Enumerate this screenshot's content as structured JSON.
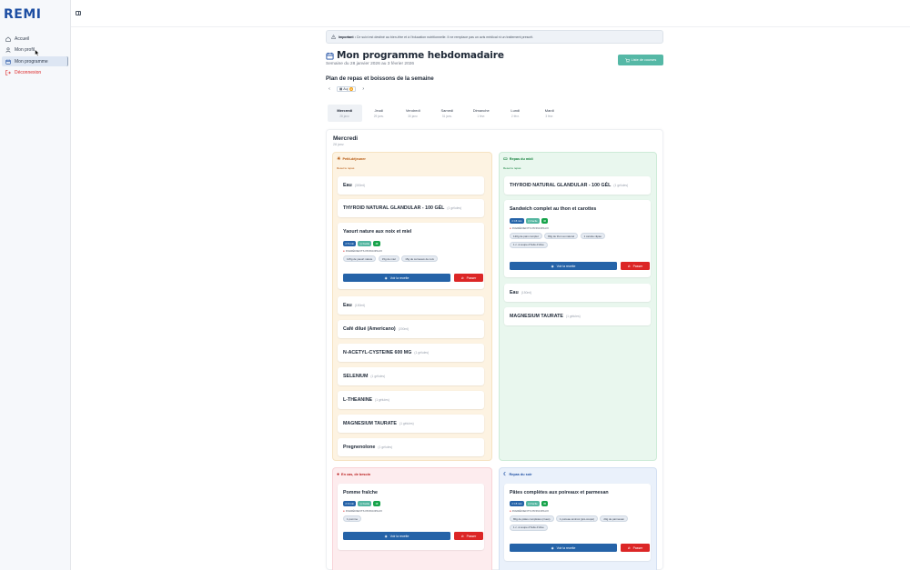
{
  "app": {
    "logo": "REMI"
  },
  "sidebar": {
    "items": [
      {
        "label": "Accueil",
        "icon": "home-icon"
      },
      {
        "label": "Mon profil",
        "icon": "user-icon"
      },
      {
        "label": "Mon programme",
        "icon": "calendar-icon",
        "active": true
      },
      {
        "label": "Déconnexion",
        "icon": "logout-icon"
      }
    ]
  },
  "banner": {
    "label": "Important :",
    "text": "Ce suivi est destiné au bien-être et à l'éducation nutritionnelle. Il ne remplace pas un avis médical ni un traitement prescrit."
  },
  "header": {
    "title": "Mon programme hebdomadaire",
    "subtitle": "Semaine du 28 janvier 2026 au 3 février 2026",
    "shopping_button": "Liste de courses"
  },
  "plan": {
    "title": "Plan de repas et boissons de la semaine",
    "today_label": "Auj",
    "today_badge": "●",
    "days": [
      {
        "name": "Mercredi",
        "date": "28 janv."
      },
      {
        "name": "Jeudi",
        "date": "29 janv."
      },
      {
        "name": "Vendredi",
        "date": "30 janv."
      },
      {
        "name": "Samedi",
        "date": "31 janv."
      },
      {
        "name": "Dimanche",
        "date": "1 févr."
      },
      {
        "name": "Lundi",
        "date": "2 févr."
      },
      {
        "name": "Mardi",
        "date": "3 févr."
      }
    ]
  },
  "selected_day": {
    "name": "Mercredi",
    "date": "28 janv."
  },
  "labels": {
    "recipe_button": "Voir la recette",
    "pass_button": "Passer",
    "ingredients": "INGRÉDIENTS PRINCIPAUX",
    "reset": "Reset le repas"
  },
  "colors": {
    "primary": "#2563a8",
    "teal": "#55b8a6",
    "danger": "#dc2626"
  },
  "meals": {
    "breakfast": {
      "title": "Petit-déjeuner",
      "items": [
        {
          "name": "Eau",
          "qty": "(300ml)"
        },
        {
          "name": "THYROID NATURAL GLANDULAR - 100 GÉL",
          "qty": "(1 gélules)"
        },
        {
          "name": "Yaourt nature aux noix et miel",
          "chips": [
            "5 min",
            "Facile",
            "4€"
          ],
          "ingredients": [
            "125g de yaourt nature",
            "15g de miel",
            "15g de cerneaux de noix"
          ]
        },
        {
          "name": "Eau",
          "qty": "(150ml)"
        },
        {
          "name": "Café dilué (Americano)",
          "qty": "(200ml)"
        },
        {
          "name": "N-ACETYL-CYSTEINE 600 MG",
          "qty": "(1 gélules)"
        },
        {
          "name": "SELENIUM",
          "qty": "(1 gélules)"
        },
        {
          "name": "L-THEANINE",
          "qty": "(1 gélules)"
        },
        {
          "name": "MAGNESIUM TAURATE",
          "qty": "(1 gélules)"
        },
        {
          "name": "Pregnenolone",
          "qty": "(1 gélules)"
        }
      ]
    },
    "lunch": {
      "title": "Repas du midi",
      "items": [
        {
          "name": "THYROID NATURAL GLANDULAR - 100 GÉL",
          "qty": "(1 gélules)"
        },
        {
          "name": "Sandwich complet au thon et carottes",
          "chips": [
            "15 min",
            "Facile",
            "4€"
          ],
          "ingredients": [
            "120g de pain complet",
            "80g de thon au naturel",
            "1 carotte râpée",
            "1 c. à soupe d'huile d'olive"
          ]
        },
        {
          "name": "Eau",
          "qty": "(150ml)"
        },
        {
          "name": "MAGNESIUM TAURATE",
          "qty": "(1 gélules)"
        }
      ]
    },
    "snack": {
      "title": "En cas, de besoin",
      "items": [
        {
          "name": "Pomme fraîche",
          "chips": [
            "0 min",
            "Facile",
            "1€"
          ],
          "ingredients": [
            "1 pomme"
          ]
        }
      ]
    },
    "dinner": {
      "title": "Repas du soir",
      "items": [
        {
          "name": "Pâtes complètes aux poireaux et parmesan",
          "chips": [
            "15 min",
            "Facile",
            "3€"
          ],
          "ingredients": [
            "80g de pâtes complètes (crues)",
            "1 poireau émincé (pré-coupé)",
            "20g de parmesan",
            "1 c. à soupe d'huile d'olive"
          ]
        }
      ]
    }
  }
}
